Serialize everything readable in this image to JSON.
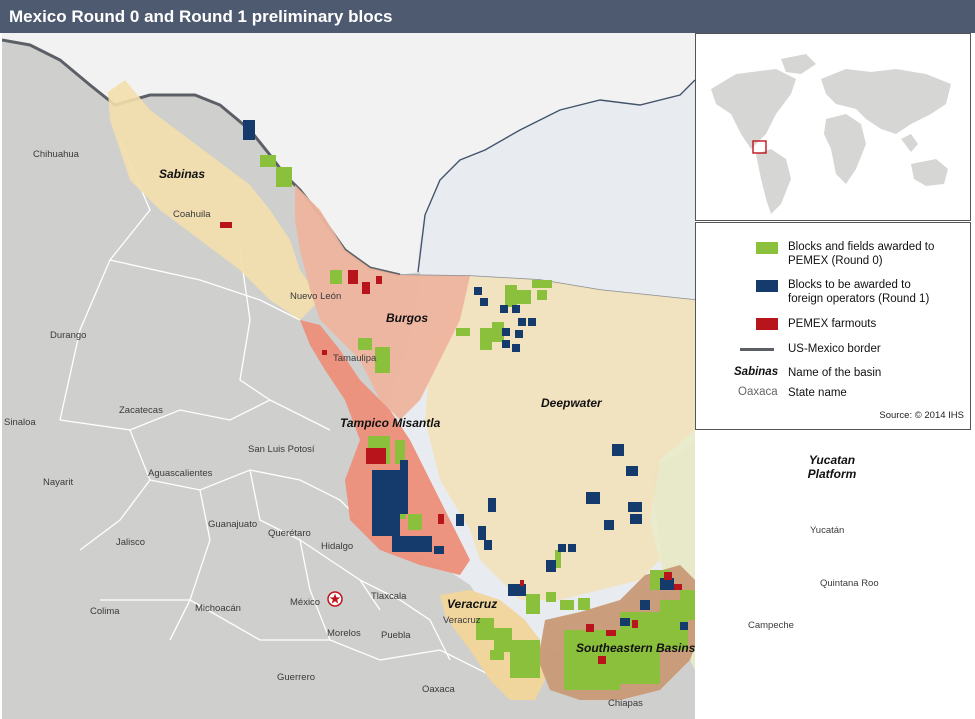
{
  "title": "Mexico Round 0 and Round 1 preliminary blocs",
  "colors": {
    "sea": "#e8ecf1",
    "land_foreign": "#f2f2f2",
    "land_mexico": "#cfcfcd",
    "state_border": "#ffffff",
    "us_mexico_border": "#5c6066",
    "coast": "#44546a",
    "deepwater": "#f2e3bd",
    "sabinas": "#f3dfad",
    "burgos": "#eeb49d",
    "tampico": "#ec8f79",
    "veracruz": "#f1d69a",
    "southeastern": "#c89a76",
    "yucatan": "#e9ebc9",
    "round0": "#8bc03c",
    "round1": "#143b6b",
    "farmout": "#b8141b"
  },
  "basins": {
    "sabinas": "Sabinas",
    "burgos": "Burgos",
    "tampico": "Tampico Misantla",
    "deepwater": "Deepwater",
    "veracruz": "Veracruz",
    "southeastern": "Southeastern Basins",
    "yucatan_line1": "Yucatan",
    "yucatan_line2": "Platform"
  },
  "states": {
    "chihuahua": "Chihuahua",
    "coahuila": "Coahuila",
    "nuevo_leon": "Nuevo León",
    "tamaulipa": "Tamaulipa",
    "durango": "Durango",
    "zacatecas": "Zacatecas",
    "sinaloa": "Sinaloa",
    "san_luis_potosi": "San Luis Potosí",
    "nayarit": "Nayarit",
    "aguascalientes": "Aguascalientes",
    "guanajuato": "Guanajuato",
    "queretaro": "Querétaro",
    "hidalgo": "Hidalgo",
    "jalisco": "Jalisco",
    "tlaxcala": "Tlaxcala",
    "mexico": "México",
    "morelos": "Morelos",
    "colima": "Colima",
    "michoacan": "Michoacán",
    "puebla": "Puebla",
    "veracruz": "Veracruz",
    "guerrero": "Guerrero",
    "oaxaca": "Oaxaca",
    "chiapas": "Chiapas",
    "yucatan": "Yucatán",
    "quintana_roo": "Quintana Roo",
    "campeche": "Campeche"
  },
  "legend": {
    "round0_line1": "Blocks and fields awarded to",
    "round0_line2": "PEMEX (Round 0)",
    "round1_line1": "Blocks to be awarded to",
    "round1_line2": "foreign operators (Round 1)",
    "farmouts": "PEMEX farmouts",
    "border": "US-Mexico border",
    "basin_example": "Sabinas",
    "basin_desc": "Name of the basin",
    "state_example": "Oaxaca",
    "state_desc": "State name",
    "source": "Source: © 2014 IHS"
  },
  "icons": {
    "capital": "star-in-circle-icon"
  }
}
